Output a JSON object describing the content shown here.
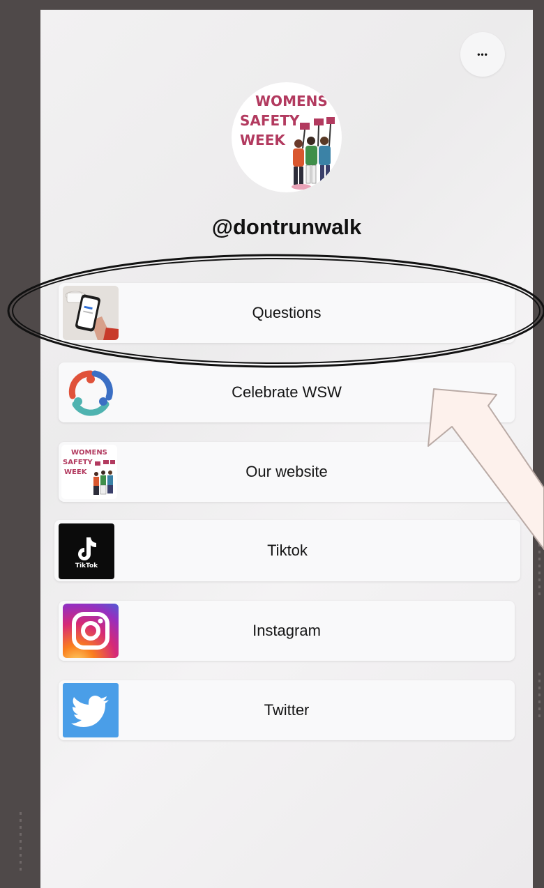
{
  "profile": {
    "username": "@dontrunwalk",
    "avatar_alt": "WOMENS SAFETY WEEK",
    "avatar_logo_lines": [
      "WOMENS",
      "SAFETY",
      "WEEK"
    ]
  },
  "more_button": {
    "icon": "more-horizontal-icon",
    "glyph": "•••"
  },
  "links": [
    {
      "label": "Questions",
      "thumb": "phone-form-thumbnail"
    },
    {
      "label": "Celebrate WSW",
      "thumb": "community-circle-logo"
    },
    {
      "label": "Our website",
      "thumb": "womens-safety-week-logo"
    },
    {
      "label": "Tiktok",
      "thumb": "tiktok-logo",
      "thumb_caption": "TikTok"
    },
    {
      "label": "Instagram",
      "thumb": "instagram-logo"
    },
    {
      "label": "Twitter",
      "thumb": "twitter-logo"
    }
  ],
  "colors": {
    "frame_bg": "#4f4949",
    "card_bg": "#f2f1f2",
    "annotation_arrow_fill": "#fdf1ec",
    "annotation_arrow_stroke": "#b9aaa5",
    "annotation_ellipse": "#111111"
  }
}
